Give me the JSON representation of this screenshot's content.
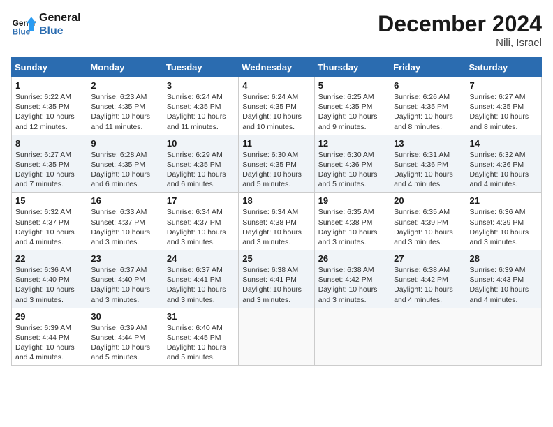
{
  "header": {
    "logo_line1": "General",
    "logo_line2": "Blue",
    "month_title": "December 2024",
    "location": "Nili, Israel"
  },
  "days_of_week": [
    "Sunday",
    "Monday",
    "Tuesday",
    "Wednesday",
    "Thursday",
    "Friday",
    "Saturday"
  ],
  "weeks": [
    [
      {
        "day": "1",
        "info": "Sunrise: 6:22 AM\nSunset: 4:35 PM\nDaylight: 10 hours\nand 12 minutes."
      },
      {
        "day": "2",
        "info": "Sunrise: 6:23 AM\nSunset: 4:35 PM\nDaylight: 10 hours\nand 11 minutes."
      },
      {
        "day": "3",
        "info": "Sunrise: 6:24 AM\nSunset: 4:35 PM\nDaylight: 10 hours\nand 11 minutes."
      },
      {
        "day": "4",
        "info": "Sunrise: 6:24 AM\nSunset: 4:35 PM\nDaylight: 10 hours\nand 10 minutes."
      },
      {
        "day": "5",
        "info": "Sunrise: 6:25 AM\nSunset: 4:35 PM\nDaylight: 10 hours\nand 9 minutes."
      },
      {
        "day": "6",
        "info": "Sunrise: 6:26 AM\nSunset: 4:35 PM\nDaylight: 10 hours\nand 8 minutes."
      },
      {
        "day": "7",
        "info": "Sunrise: 6:27 AM\nSunset: 4:35 PM\nDaylight: 10 hours\nand 8 minutes."
      }
    ],
    [
      {
        "day": "8",
        "info": "Sunrise: 6:27 AM\nSunset: 4:35 PM\nDaylight: 10 hours\nand 7 minutes."
      },
      {
        "day": "9",
        "info": "Sunrise: 6:28 AM\nSunset: 4:35 PM\nDaylight: 10 hours\nand 6 minutes."
      },
      {
        "day": "10",
        "info": "Sunrise: 6:29 AM\nSunset: 4:35 PM\nDaylight: 10 hours\nand 6 minutes."
      },
      {
        "day": "11",
        "info": "Sunrise: 6:30 AM\nSunset: 4:35 PM\nDaylight: 10 hours\nand 5 minutes."
      },
      {
        "day": "12",
        "info": "Sunrise: 6:30 AM\nSunset: 4:36 PM\nDaylight: 10 hours\nand 5 minutes."
      },
      {
        "day": "13",
        "info": "Sunrise: 6:31 AM\nSunset: 4:36 PM\nDaylight: 10 hours\nand 4 minutes."
      },
      {
        "day": "14",
        "info": "Sunrise: 6:32 AM\nSunset: 4:36 PM\nDaylight: 10 hours\nand 4 minutes."
      }
    ],
    [
      {
        "day": "15",
        "info": "Sunrise: 6:32 AM\nSunset: 4:37 PM\nDaylight: 10 hours\nand 4 minutes."
      },
      {
        "day": "16",
        "info": "Sunrise: 6:33 AM\nSunset: 4:37 PM\nDaylight: 10 hours\nand 3 minutes."
      },
      {
        "day": "17",
        "info": "Sunrise: 6:34 AM\nSunset: 4:37 PM\nDaylight: 10 hours\nand 3 minutes."
      },
      {
        "day": "18",
        "info": "Sunrise: 6:34 AM\nSunset: 4:38 PM\nDaylight: 10 hours\nand 3 minutes."
      },
      {
        "day": "19",
        "info": "Sunrise: 6:35 AM\nSunset: 4:38 PM\nDaylight: 10 hours\nand 3 minutes."
      },
      {
        "day": "20",
        "info": "Sunrise: 6:35 AM\nSunset: 4:39 PM\nDaylight: 10 hours\nand 3 minutes."
      },
      {
        "day": "21",
        "info": "Sunrise: 6:36 AM\nSunset: 4:39 PM\nDaylight: 10 hours\nand 3 minutes."
      }
    ],
    [
      {
        "day": "22",
        "info": "Sunrise: 6:36 AM\nSunset: 4:40 PM\nDaylight: 10 hours\nand 3 minutes."
      },
      {
        "day": "23",
        "info": "Sunrise: 6:37 AM\nSunset: 4:40 PM\nDaylight: 10 hours\nand 3 minutes."
      },
      {
        "day": "24",
        "info": "Sunrise: 6:37 AM\nSunset: 4:41 PM\nDaylight: 10 hours\nand 3 minutes."
      },
      {
        "day": "25",
        "info": "Sunrise: 6:38 AM\nSunset: 4:41 PM\nDaylight: 10 hours\nand 3 minutes."
      },
      {
        "day": "26",
        "info": "Sunrise: 6:38 AM\nSunset: 4:42 PM\nDaylight: 10 hours\nand 3 minutes."
      },
      {
        "day": "27",
        "info": "Sunrise: 6:38 AM\nSunset: 4:42 PM\nDaylight: 10 hours\nand 4 minutes."
      },
      {
        "day": "28",
        "info": "Sunrise: 6:39 AM\nSunset: 4:43 PM\nDaylight: 10 hours\nand 4 minutes."
      }
    ],
    [
      {
        "day": "29",
        "info": "Sunrise: 6:39 AM\nSunset: 4:44 PM\nDaylight: 10 hours\nand 4 minutes."
      },
      {
        "day": "30",
        "info": "Sunrise: 6:39 AM\nSunset: 4:44 PM\nDaylight: 10 hours\nand 5 minutes."
      },
      {
        "day": "31",
        "info": "Sunrise: 6:40 AM\nSunset: 4:45 PM\nDaylight: 10 hours\nand 5 minutes."
      },
      null,
      null,
      null,
      null
    ]
  ]
}
